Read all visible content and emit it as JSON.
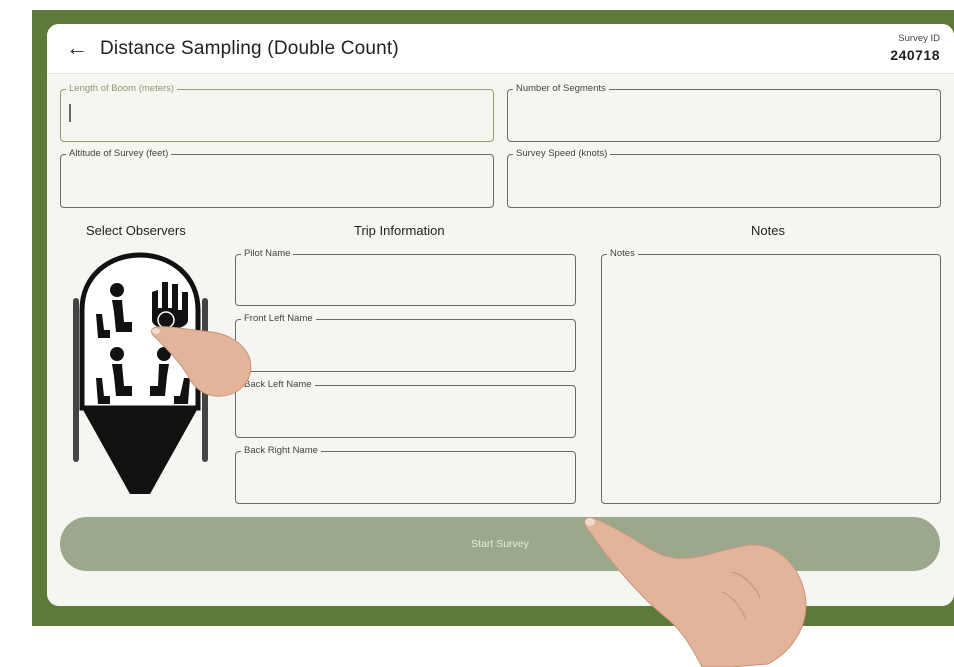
{
  "header": {
    "back_icon": "arrow-left-icon",
    "title": "Distance Sampling (Double Count)",
    "survey_id_label": "Survey ID",
    "survey_id_value": "240718"
  },
  "fields": {
    "length_of_boom": {
      "label": "Length of Boom (meters)",
      "value": ""
    },
    "number_of_segments": {
      "label": "Number of Segments",
      "value": ""
    },
    "altitude": {
      "label": "Altitude of Survey (feet)",
      "value": ""
    },
    "survey_speed": {
      "label": "Survey Speed (knots)",
      "value": ""
    }
  },
  "sections": {
    "observers": "Select Observers",
    "trip": "Trip Information",
    "notes": "Notes"
  },
  "trip": {
    "pilot": "Pilot Name",
    "front_left": "Front Left Name",
    "back_left": "Back Left Name",
    "back_right": "Back Right Name"
  },
  "notes": {
    "label": "Notes",
    "value": ""
  },
  "start_button": "Start Survey",
  "colors": {
    "frame": "#5e7a3a",
    "accent": "#8fa06a",
    "button": "#9ca88c"
  }
}
